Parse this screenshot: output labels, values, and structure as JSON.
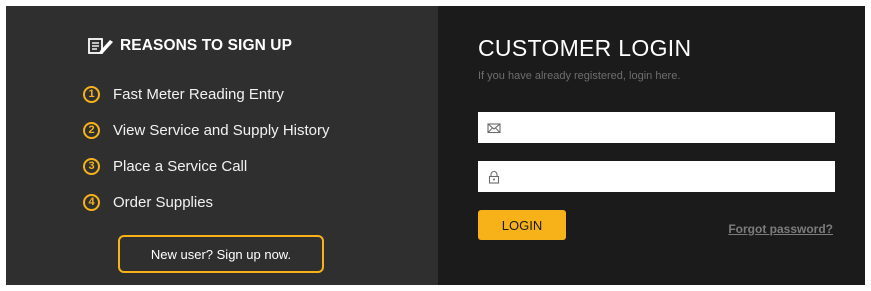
{
  "left": {
    "heading_icon": "edit-document-icon",
    "heading": "REASONS TO SIGN UP",
    "reasons": [
      {
        "number": "1",
        "label": "Fast Meter Reading Entry"
      },
      {
        "number": "2",
        "label": "View Service and Supply History"
      },
      {
        "number": "3",
        "label": "Place a Service Call"
      },
      {
        "number": "4",
        "label": "Order Supplies"
      }
    ],
    "signup_button": "New user? Sign up now."
  },
  "right": {
    "title": "CUSTOMER LOGIN",
    "subtitle": "If you have already registered, login here.",
    "email": {
      "icon": "envelope-icon",
      "value": "",
      "placeholder": ""
    },
    "password": {
      "icon": "lock-icon",
      "value": "",
      "placeholder": ""
    },
    "login_button": "LOGIN",
    "forgot_link": "Forgot password?"
  },
  "colors": {
    "accent": "#f7b21a",
    "left_bg": "#2f2f2f",
    "right_bg": "#1b1b1b"
  }
}
